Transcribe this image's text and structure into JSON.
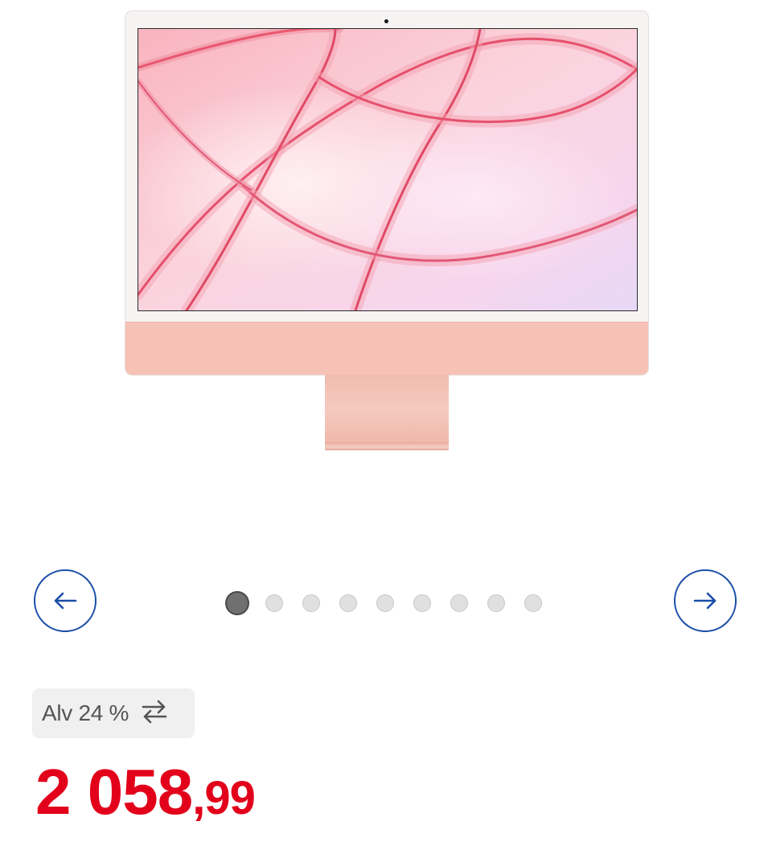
{
  "product": {
    "image_alt": "iMac pink"
  },
  "carousel": {
    "prev_icon": "arrow-left-icon",
    "next_icon": "arrow-right-icon",
    "total_slides": 9,
    "active_index": 0,
    "accent_color": "#1a4ea8"
  },
  "vat": {
    "label": "Alv 24 %",
    "icon": "swap-arrows-icon"
  },
  "price": {
    "main": "2 058",
    "decimals": ",99",
    "color": "#e2001a"
  }
}
